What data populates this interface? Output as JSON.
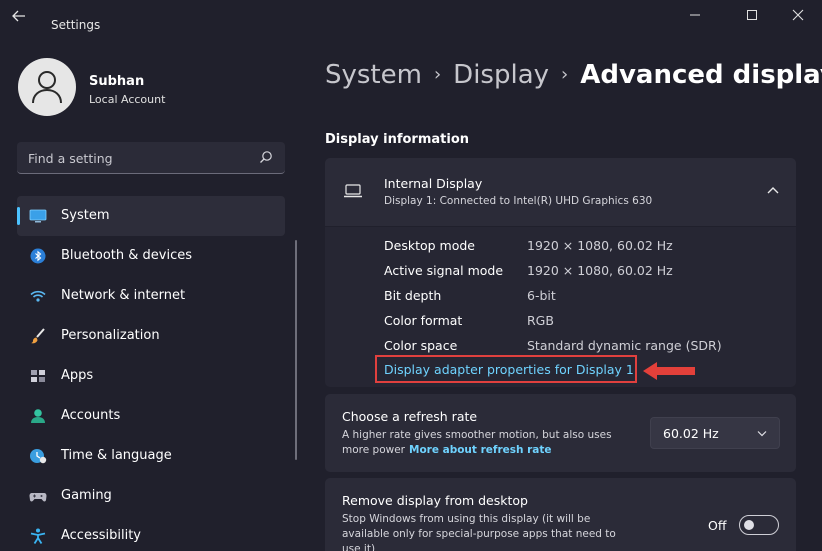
{
  "window": {
    "app_title": "Settings",
    "controls": {
      "minimize": "—",
      "maximize": "☐",
      "close": "✕"
    }
  },
  "profile": {
    "name": "Subhan",
    "account_type": "Local Account"
  },
  "search": {
    "placeholder": "Find a setting"
  },
  "sidebar": {
    "items": [
      {
        "label": "System",
        "icon": "system-icon",
        "active": true
      },
      {
        "label": "Bluetooth & devices",
        "icon": "bluetooth-icon"
      },
      {
        "label": "Network & internet",
        "icon": "wifi-icon"
      },
      {
        "label": "Personalization",
        "icon": "brush-icon"
      },
      {
        "label": "Apps",
        "icon": "apps-icon"
      },
      {
        "label": "Accounts",
        "icon": "accounts-icon"
      },
      {
        "label": "Time & language",
        "icon": "time-language-icon"
      },
      {
        "label": "Gaming",
        "icon": "gaming-icon"
      },
      {
        "label": "Accessibility",
        "icon": "accessibility-icon"
      }
    ]
  },
  "breadcrumb": {
    "parts": [
      "System",
      "Display"
    ],
    "current": "Advanced display"
  },
  "display_info": {
    "section_title": "Display information",
    "display_name": "Internal Display",
    "display_sub": "Display 1: Connected to Intel(R) UHD Graphics 630",
    "rows": [
      {
        "key": "Desktop mode",
        "value": "1920 × 1080, 60.02 Hz"
      },
      {
        "key": "Active signal mode",
        "value": "1920 × 1080, 60.02 Hz"
      },
      {
        "key": "Bit depth",
        "value": "6-bit"
      },
      {
        "key": "Color format",
        "value": "RGB"
      },
      {
        "key": "Color space",
        "value": "Standard dynamic range (SDR)"
      }
    ],
    "adapter_link": "Display adapter properties for Display 1"
  },
  "refresh": {
    "title": "Choose a refresh rate",
    "desc": "A higher rate gives smoother motion, but also uses more power",
    "link": "More about refresh rate",
    "selected": "60.02 Hz"
  },
  "remove": {
    "title": "Remove display from desktop",
    "desc": "Stop Windows from using this display (it will be available only for special-purpose apps that need to use it)",
    "toggle_label": "Off",
    "toggle_on": false
  },
  "colors": {
    "accent": "#4cc2ff",
    "link": "#6fd3ff",
    "highlight_box": "#e0403e",
    "background": "#20202c",
    "card": "#2b2b38"
  }
}
